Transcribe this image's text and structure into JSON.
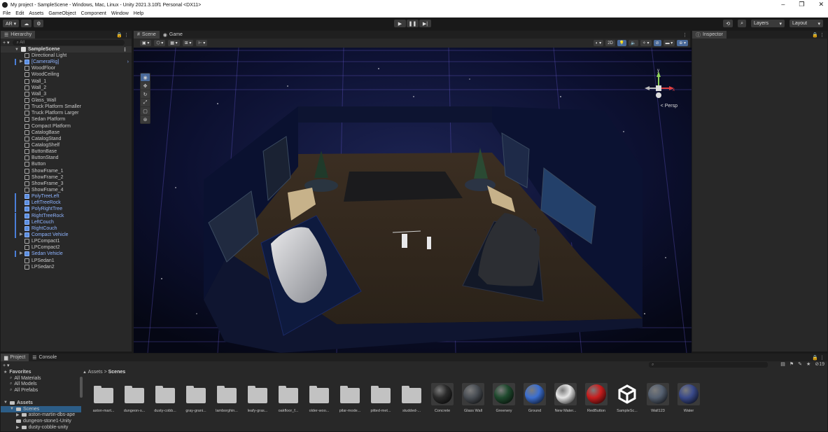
{
  "window": {
    "title": "My project - SampleScene - Windows, Mac, Linux - Unity 2021.3.10f1 Personal <DX11>",
    "controls": [
      "–",
      "❐",
      "✕"
    ]
  },
  "menu": [
    "File",
    "Edit",
    "Assets",
    "GameObject",
    "Component",
    "Window",
    "Help"
  ],
  "toolbar": {
    "account": "AR ▾",
    "cloud": "☁",
    "collab": "⚙",
    "play": "▶",
    "pause": "❚❚",
    "step": "▶|",
    "history": "⟲",
    "search": "⌕",
    "layers": "Layers",
    "layout": "Layout"
  },
  "hierarchy": {
    "tab": "Hierarchy",
    "add": "+ ▾",
    "search_placeholder": "All",
    "scene": "SampleScene",
    "items": [
      {
        "name": "Directional Light",
        "prefab": false
      },
      {
        "name": "[CameraRig]",
        "prefab": true,
        "expandable": true
      },
      {
        "name": "WoodFloor",
        "prefab": false
      },
      {
        "name": "WoodCeiling",
        "prefab": false
      },
      {
        "name": "Wall_1",
        "prefab": false
      },
      {
        "name": "Wall_2",
        "prefab": false
      },
      {
        "name": "Wall_3",
        "prefab": false
      },
      {
        "name": "Glass_Wall",
        "prefab": false
      },
      {
        "name": "Truck Platform Smaller",
        "prefab": false
      },
      {
        "name": "Truck Platform Larger",
        "prefab": false
      },
      {
        "name": "Sedan Platform",
        "prefab": false
      },
      {
        "name": "Compact Platform",
        "prefab": false
      },
      {
        "name": "CatalogBase",
        "prefab": false
      },
      {
        "name": "CatalogStand",
        "prefab": false
      },
      {
        "name": "CatalogShelf",
        "prefab": false
      },
      {
        "name": "ButtonBase",
        "prefab": false
      },
      {
        "name": "ButtonStand",
        "prefab": false
      },
      {
        "name": "Button",
        "prefab": false
      },
      {
        "name": "ShowFrame_1",
        "prefab": false
      },
      {
        "name": "ShowFrame_2",
        "prefab": false
      },
      {
        "name": "ShowFrame_3",
        "prefab": false
      },
      {
        "name": "ShowFrame_4",
        "prefab": false
      },
      {
        "name": "PolyTreeLeft",
        "prefab": true
      },
      {
        "name": "LeftTreeRock",
        "prefab": true
      },
      {
        "name": "PolyRightTree",
        "prefab": true
      },
      {
        "name": "RightTreeRock",
        "prefab": true
      },
      {
        "name": "LeftCouch",
        "prefab": true
      },
      {
        "name": "RightCouch",
        "prefab": true
      },
      {
        "name": "Compact Vehicle",
        "prefab": true,
        "expandable": true
      },
      {
        "name": "LPCompact1",
        "prefab": false
      },
      {
        "name": "LPCompact2",
        "prefab": false
      },
      {
        "name": "Sedan Vehicle",
        "prefab": true,
        "expandable": true
      },
      {
        "name": "LPSedan1",
        "prefab": false
      },
      {
        "name": "LPSedan2",
        "prefab": false
      }
    ]
  },
  "scene": {
    "tabs": [
      {
        "label": "Scene",
        "icon": "#"
      },
      {
        "label": "Game",
        "icon": "◉"
      }
    ],
    "btn_2d": "2D",
    "persp": "< Persp",
    "gizmo_y": "y",
    "gizmo_x": "x"
  },
  "inspector": {
    "tab": "Inspector"
  },
  "project": {
    "tabs": [
      "Project",
      "Console"
    ],
    "add": "+ ▾",
    "tree": [
      {
        "label": "Favorites",
        "level": 0,
        "icon": "★",
        "bold": true
      },
      {
        "label": "All Materials",
        "level": 1,
        "icon": "⌕"
      },
      {
        "label": "All Models",
        "level": 1,
        "icon": "⌕"
      },
      {
        "label": "All Prefabs",
        "level": 1,
        "icon": "⌕"
      },
      {
        "label": "",
        "level": 1,
        "icon": ""
      },
      {
        "label": "Assets",
        "level": 0,
        "icon": "▼",
        "bold": true
      },
      {
        "label": "Scenes",
        "level": 1,
        "icon": "▼",
        "selected": true
      },
      {
        "label": "aston-martin-dbs-ape",
        "level": 2,
        "icon": "▶"
      },
      {
        "label": "dungeon-stone1-Unity",
        "level": 2,
        "icon": ""
      },
      {
        "label": "dusty-cobble-unity",
        "level": 2,
        "icon": "▶"
      }
    ],
    "breadcrumb_root": "Assets",
    "breadcrumb_sep": ">",
    "breadcrumb_current": "Scenes",
    "hidden_count": "19",
    "assets": [
      {
        "label": "aston-mart...",
        "kind": "folder"
      },
      {
        "label": "dungeon-s...",
        "kind": "folder"
      },
      {
        "label": "dusty-cobb...",
        "kind": "folder"
      },
      {
        "label": "gray-grani...",
        "kind": "folder"
      },
      {
        "label": "lamborghin...",
        "kind": "folder"
      },
      {
        "label": "leafy-gras...",
        "kind": "folder"
      },
      {
        "label": "oakfloor_f...",
        "kind": "folder"
      },
      {
        "label": "older-woo...",
        "kind": "folder"
      },
      {
        "label": "pilar-mode...",
        "kind": "folder"
      },
      {
        "label": "pitted-met...",
        "kind": "folder"
      },
      {
        "label": "studded-...",
        "kind": "folder"
      },
      {
        "label": "Concrete",
        "kind": "sphere",
        "color": "#2b2b2b"
      },
      {
        "label": "Glass Wall",
        "kind": "sphere",
        "color": "#4a4f55"
      },
      {
        "label": "Greenery",
        "kind": "sphere",
        "color": "#1f4a2e"
      },
      {
        "label": "Ground",
        "kind": "sphere",
        "color": "#3c6fd0"
      },
      {
        "label": "New Mater...",
        "kind": "sphere",
        "color": "#e6e6e6"
      },
      {
        "label": "RedButton",
        "kind": "sphere",
        "color": "#c81e1e"
      },
      {
        "label": "SampleSc...",
        "kind": "unity"
      },
      {
        "label": "Wall123",
        "kind": "sphere",
        "color": "#556070"
      },
      {
        "label": "Water",
        "kind": "sphere",
        "color": "#3a4a8a"
      }
    ]
  }
}
